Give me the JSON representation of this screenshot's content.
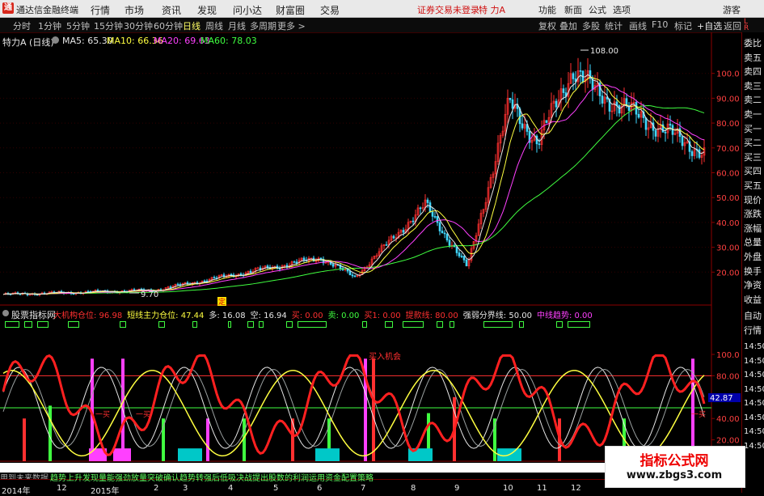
{
  "app": {
    "title": "通达信金融终端",
    "menus": [
      "行情",
      "市场",
      "资讯",
      "发现",
      "问小达",
      "财富圈",
      "交易"
    ],
    "login_warning": "证券交易未登录",
    "stock_short": "特 力A",
    "right_buttons": [
      "功能",
      "新面",
      "公式",
      "选项"
    ],
    "guest": "游客"
  },
  "toolbar": {
    "periods": [
      "分时",
      "1分钟",
      "5分钟",
      "15分钟",
      "30分钟",
      "60分钟",
      "日线",
      "周线",
      "月线",
      "多周期",
      "更多 >"
    ],
    "active_period": "日线",
    "right_tools": [
      "复权",
      "叠加",
      "多股",
      "统计",
      "画线",
      "F10",
      "标记",
      "+自选",
      "返回"
    ]
  },
  "main_chart": {
    "title": "特力A (日线)",
    "ma": [
      {
        "label": "MA5: 65.30",
        "color": "#e6e6e6"
      },
      {
        "label": "MA10: 66.36",
        "color": "#ffff40"
      },
      {
        "label": "MA20: 69.63",
        "color": "#ff40ff"
      },
      {
        "label": "MA60: 78.03",
        "color": "#40ff40"
      }
    ],
    "y_ticks": [
      "100.0",
      "90.00",
      "80.00",
      "70.00",
      "60.00",
      "50.00",
      "40.00",
      "30.00",
      "20.00"
    ],
    "high_marker": "108.00",
    "low_marker": "9.70",
    "flag_label": "定"
  },
  "indicator": {
    "title": "股票指标网",
    "legend": [
      {
        "text": "大机构仓位: 96.98",
        "color": "#ff3030"
      },
      {
        "text": "短线主力仓位: 47.44",
        "color": "#ffff40"
      },
      {
        "text": "多: 16.08",
        "color": "#e6e6e6"
      },
      {
        "text": "空: 16.94",
        "color": "#e6e6e6"
      },
      {
        "text": "买: 0.00",
        "color": "#ff3030"
      },
      {
        "text": "卖: 0.00",
        "color": "#40ff40"
      },
      {
        "text": "买1: 0.00",
        "color": "#ff3030"
      },
      {
        "text": "提款线: 80.00",
        "color": "#ff3030"
      },
      {
        "text": "强弱分界线: 50.00",
        "color": "#e6e6e6"
      },
      {
        "text": "中线趋势: 0.00",
        "color": "#ff40ff"
      }
    ],
    "y_ticks": [
      "100.0",
      "80.00",
      "60.00",
      "40.00",
      "20.00"
    ],
    "current_value": "42.87",
    "annotations": [
      "买入机会",
      "一买"
    ]
  },
  "side_panel": {
    "items": [
      "委比",
      "卖五",
      "卖四",
      "卖三",
      "卖二",
      "卖一",
      "买一",
      "买二",
      "买三",
      "买四",
      "买五",
      "现价",
      "涨跌",
      "涨幅",
      "总量",
      "外盘",
      "换手",
      "净资",
      "收益",
      "自动",
      "行情"
    ],
    "times": [
      "14:50",
      "14:50",
      "14:50",
      "14:50",
      "14:50",
      "14:50",
      "14:50",
      "14:50"
    ]
  },
  "bottom": {
    "hint": "用到未来数据",
    "scroll_text": "趋势上升发现量能强劲放量突破确认趋势转强后低吸决战提出股数的利润运用资金配置策略",
    "years": [
      "2014年",
      "2015年"
    ],
    "months": [
      "12",
      "1",
      "2",
      "3",
      "4",
      "5",
      "6",
      "7",
      "8",
      "9",
      "10",
      "11",
      "12"
    ]
  },
  "watermark": {
    "line1": "指标公式网",
    "line2": "www.zbgs3.com"
  },
  "colors": {
    "up": "#ff3030",
    "down": "#40ff40",
    "axis": "#8b0000",
    "ma5": "#e6e6e6",
    "ma10": "#ffff40",
    "ma20": "#ff40ff",
    "ma60": "#40ff40",
    "cyan": "#00c8c8"
  }
}
